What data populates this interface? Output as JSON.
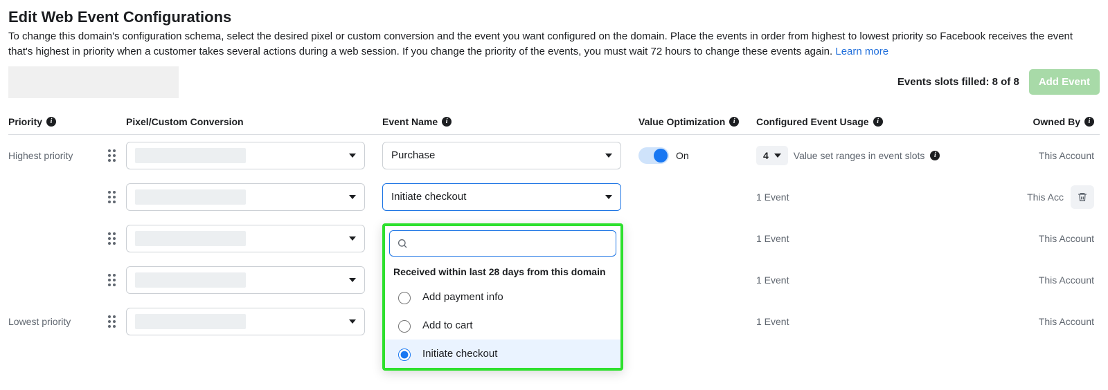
{
  "page_title": "Edit Web Event Configurations",
  "subtitle_part1": "To change this domain's configuration schema, select the desired pixel or custom conversion and the event you want configured on the domain. Place the events in order from highest to lowest priority so Facebook receives the event that's highest in priority when a customer takes several actions during a web session. If you change the priority of the events, you must wait 72 hours to change these events again. ",
  "learn_more": "Learn more",
  "slots_text": "Events slots filled: 8 of 8",
  "add_event_label": "Add Event",
  "columns": {
    "priority": "Priority",
    "pixel": "Pixel/Custom Conversion",
    "event_name": "Event Name",
    "value_opt": "Value Optimization",
    "usage": "Configured Event Usage",
    "owned_by": "Owned By"
  },
  "toggle_on_label": "On",
  "value_chip": {
    "count": "4",
    "caption": "Value set ranges in event slots"
  },
  "rows": [
    {
      "priority_label": "Highest priority",
      "event_name": "Purchase",
      "value_opt": true,
      "usage": "",
      "owner": "This Account"
    },
    {
      "priority_label": "",
      "event_name": "Initiate checkout",
      "value_opt": false,
      "usage": "1 Event",
      "owner": "This Acc",
      "show_trash": true,
      "focused": true
    },
    {
      "priority_label": "",
      "event_name": "",
      "value_opt": false,
      "usage": "1 Event",
      "owner": "This Account"
    },
    {
      "priority_label": "",
      "event_name": "",
      "value_opt": false,
      "usage": "1 Event",
      "owner": "This Account"
    },
    {
      "priority_label": "Lowest priority",
      "event_name": "",
      "value_opt": false,
      "usage": "1 Event",
      "owner": "This Account"
    }
  ],
  "dropdown": {
    "section_header": "Received within last 28 days from this domain",
    "options": [
      {
        "label": "Add payment info",
        "selected": false
      },
      {
        "label": "Add to cart",
        "selected": false
      },
      {
        "label": "Initiate checkout",
        "selected": true
      }
    ]
  }
}
